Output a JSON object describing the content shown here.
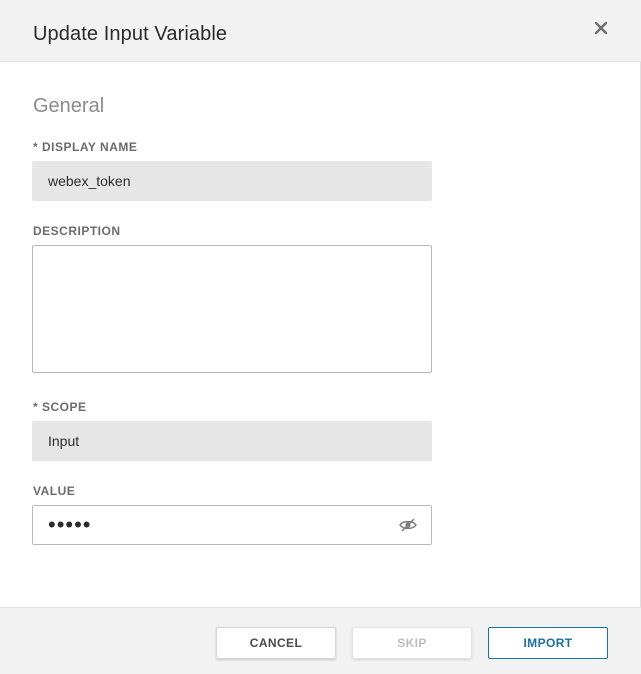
{
  "dialog": {
    "title": "Update Input Variable",
    "close_icon": "close-icon"
  },
  "section": {
    "title": "General"
  },
  "fields": {
    "display_name": {
      "label": "* DISPLAY NAME",
      "value": "webex_token"
    },
    "description": {
      "label": "DESCRIPTION",
      "value": ""
    },
    "scope": {
      "label": "* SCOPE",
      "value": "Input"
    },
    "value": {
      "label": "VALUE",
      "masked_value": "•••••",
      "reveal_icon": "eye-icon"
    }
  },
  "footer": {
    "cancel_label": "CANCEL",
    "skip_label": "SKIP",
    "import_label": "IMPORT"
  },
  "colors": {
    "header_bg": "#f2f2f2",
    "readonly_bg": "#e6e6e6",
    "primary_border": "#1a73a8",
    "disabled_text": "#bdbdbd"
  }
}
